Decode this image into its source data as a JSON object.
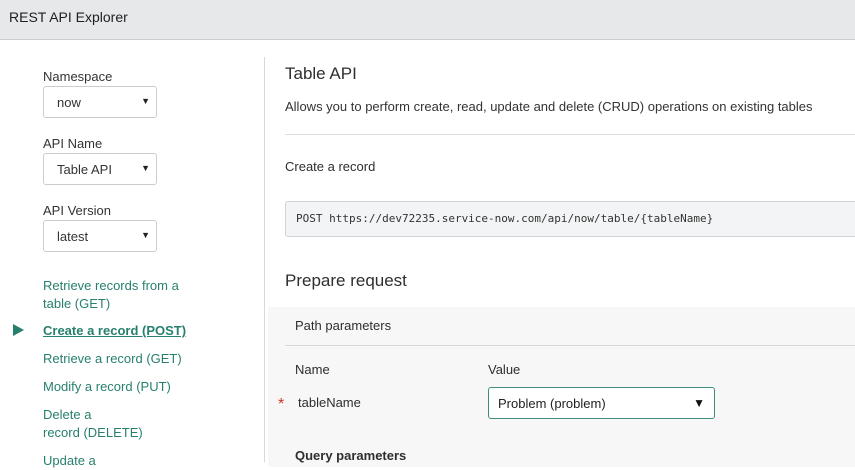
{
  "header": {
    "title": "REST API Explorer"
  },
  "sidebar": {
    "namespace": {
      "label": "Namespace",
      "value": "now"
    },
    "api_name": {
      "label": "API Name",
      "value": "Table API"
    },
    "api_version": {
      "label": "API Version",
      "value": "latest"
    },
    "links": [
      {
        "line1": "Retrieve records from a",
        "line2": "table  (GET)"
      },
      {
        "label": "Create a record  (POST)",
        "active": true
      },
      {
        "label": "Retrieve a record  (GET)"
      },
      {
        "label": "Modify a record  (PUT)"
      },
      {
        "line1": "Delete a",
        "line2": "record  (DELETE)"
      },
      {
        "line1": "Update a"
      }
    ]
  },
  "main": {
    "title": "Table API",
    "description": "Allows you to perform create, read, update and delete (CRUD) operations on existing tables",
    "operation_title": "Create a record",
    "endpoint": "POST https://dev72235.service-now.com/api/now/table/{tableName}",
    "prepare_title": "Prepare request",
    "path_params": {
      "title": "Path parameters",
      "col_name": "Name",
      "col_value": "Value",
      "required_mark": "*",
      "row_name": "tableName",
      "row_value": "Problem (problem)"
    },
    "query_params_title": "Query parameters"
  },
  "colors": {
    "accent": "#27806e",
    "required": "#d0342c",
    "header_bg": "#e6e8ea"
  }
}
